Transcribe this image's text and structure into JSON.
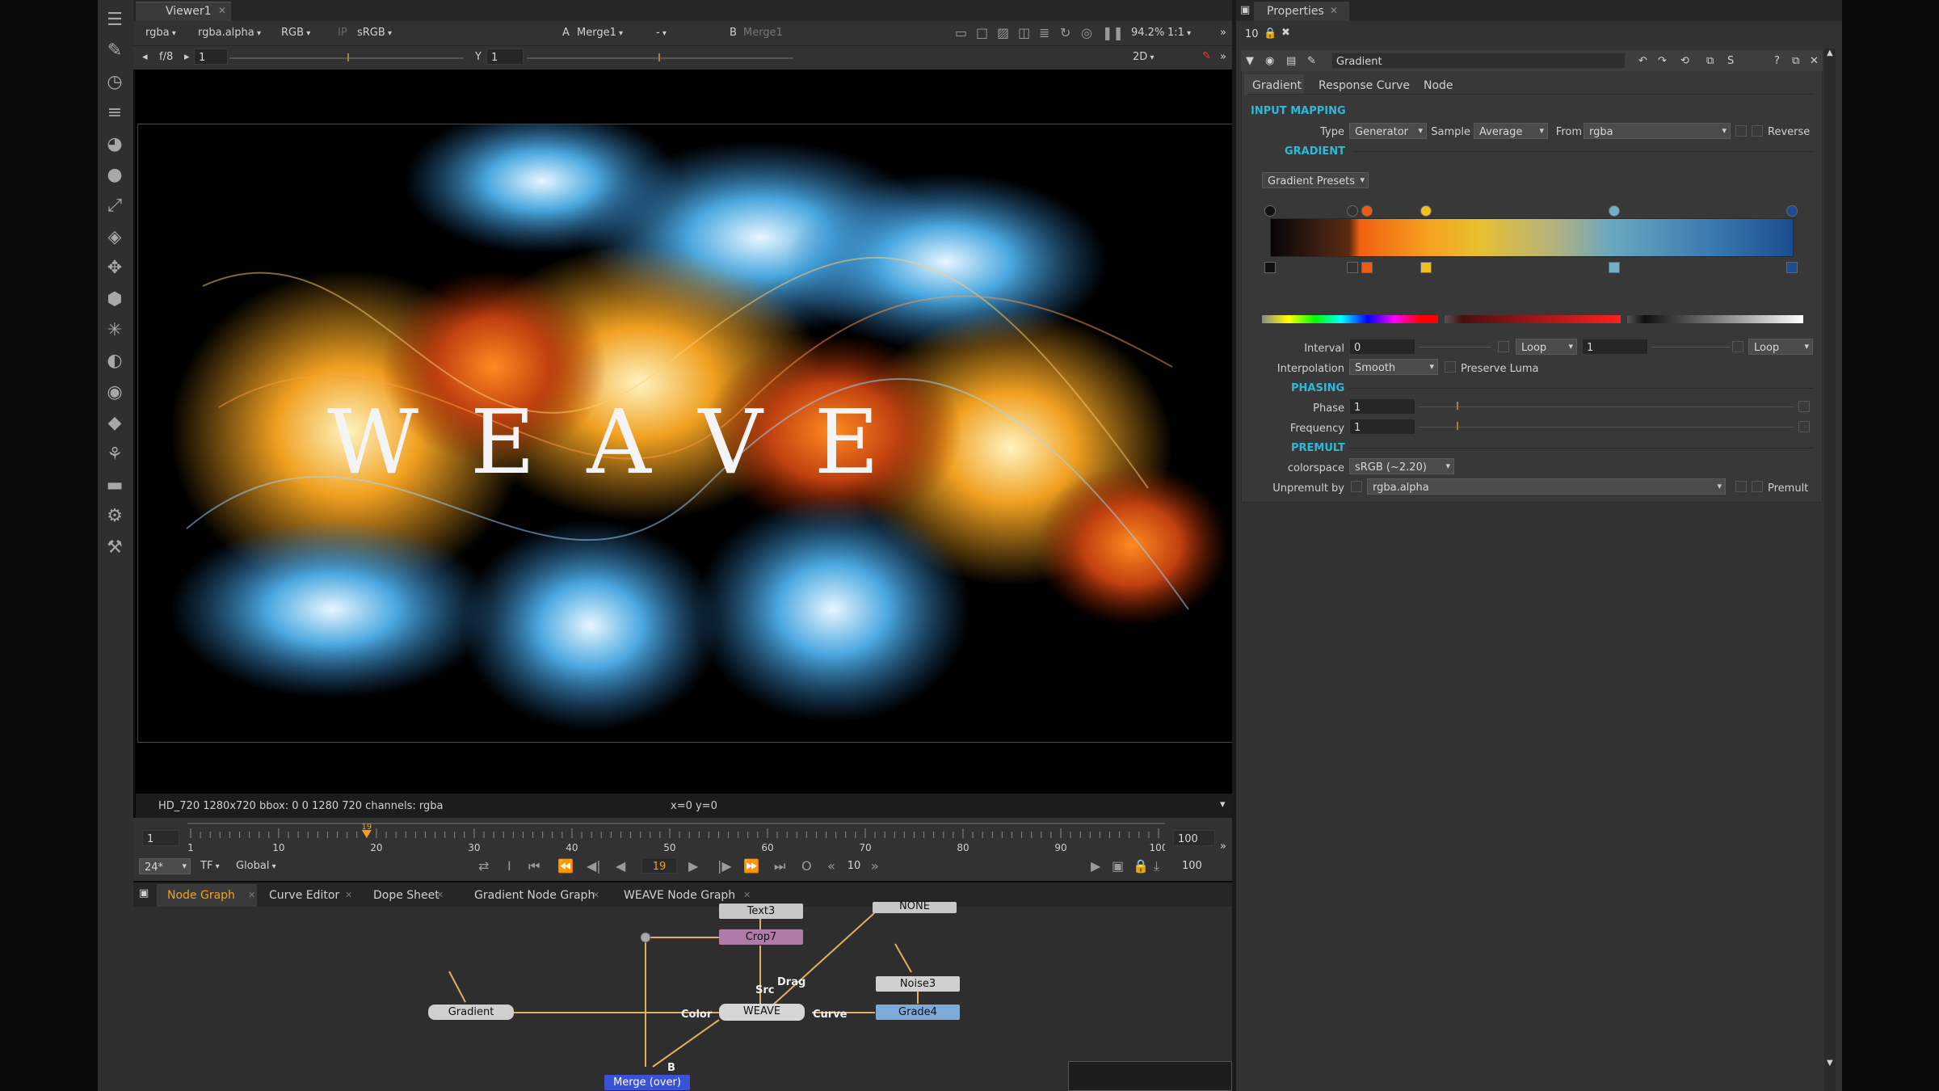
{
  "colors": {
    "accent": "#2fb8d8",
    "timeline_marker": "#f0a020",
    "node_tab_active": "#f0a020"
  },
  "toolbar": {
    "icons": [
      "nodes-menu-icon",
      "paint-brush-icon",
      "time-icon",
      "channel-icon",
      "color-icon",
      "circle-icon",
      "curve-icon",
      "layers-icon",
      "transform-icon",
      "3d-cube-icon",
      "particle-icon",
      "deep-icon",
      "eye-icon",
      "keyer-icon",
      "merge-icon",
      "filter-icon",
      "other-icon",
      "toolsets-icon"
    ]
  },
  "viewer": {
    "tab_label": "Viewer1",
    "row1": {
      "channels": "rgba",
      "alpha": "rgba.alpha",
      "display": "RGB",
      "ip": "IP",
      "colorspace": "sRGB",
      "a_label": "A",
      "a_input": "Merge1",
      "a_op": "-",
      "b_label": "B",
      "b_input": "Merge1",
      "zoom": "94.2%",
      "ratio": "1:1"
    },
    "row2": {
      "fstop": "f/8",
      "gain_value": "1",
      "y_label": "Y",
      "gamma_value": "1",
      "mode": "2D"
    },
    "image_text": "WEAVE",
    "status_format": "HD_720 1280x720  bbox: 0 0 1280 720 channels: rgba",
    "status_coords": "x=0 y=0"
  },
  "timeline": {
    "start": "1",
    "end": "100",
    "current_marker": "19",
    "ticks": [
      "1",
      "10",
      "20",
      "30",
      "40",
      "50",
      "60",
      "70",
      "80",
      "90",
      "100"
    ],
    "fps": "24*",
    "tf": "TF",
    "scope": "Global",
    "frame": "19",
    "step": "10",
    "end_field": "100"
  },
  "node_tabs": [
    "Node Graph",
    "Curve Editor",
    "Dope Sheet",
    "Gradient Node Graph",
    "WEAVE Node Graph"
  ],
  "nodes": {
    "text3": "Text3",
    "crop7": "Crop7",
    "none": "NONE",
    "noise3": "Noise3",
    "grade4": "Grade4",
    "gradient": "Gradient",
    "weave": "WEAVE",
    "merge": "Merge (over)",
    "edge_labels": {
      "drag": "Drag",
      "src": "Src",
      "color": "Color",
      "curve": "Curve",
      "b": "B"
    }
  },
  "properties": {
    "tab_label": "Properties",
    "max_panels": "10",
    "node_name": "Gradient",
    "tabs": [
      "Gradient",
      "Response Curve",
      "Node"
    ],
    "input_mapping": {
      "header": "INPUT MAPPING",
      "type_label": "Type",
      "type_value": "Generator",
      "sample_label": "Sample",
      "sample_value": "Average",
      "from_label": "From",
      "from_value": "rgba",
      "reverse_label": "Reverse"
    },
    "gradient": {
      "header": "GRADIENT",
      "presets": "Gradient Presets"
    },
    "interval": {
      "label": "Interval",
      "start": "0",
      "loop1": "Loop",
      "end": "1",
      "loop2": "Loop"
    },
    "interpolation": {
      "label": "Interpolation",
      "value": "Smooth",
      "preserve_luma": "Preserve Luma"
    },
    "phasing": {
      "header": "PHASING",
      "phase_label": "Phase",
      "phase_value": "1",
      "frequency_label": "Frequency",
      "frequency_value": "1"
    },
    "premult": {
      "header": "PREMULT",
      "colorspace_label": "colorspace",
      "colorspace_value": "sRGB (~2.20)",
      "unpremult_label": "Unpremult by",
      "unpremult_value": "rgba.alpha",
      "premult_label": "Premult"
    }
  }
}
